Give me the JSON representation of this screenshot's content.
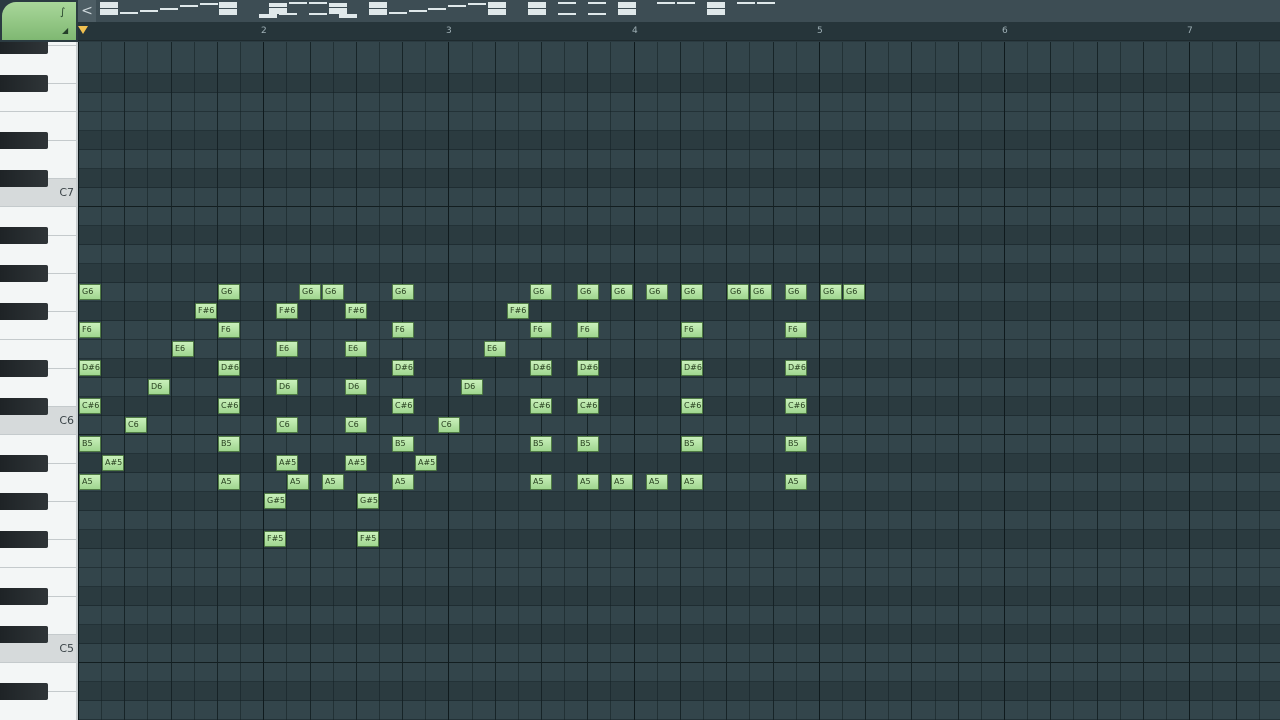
{
  "overview": {
    "scroll_left_label": "<"
  },
  "ruler": {
    "bars": [
      "2",
      "3",
      "4",
      "5",
      "6",
      "7"
    ]
  },
  "keyboard": {
    "octave_labels": [
      "C7",
      "C6",
      "C5"
    ]
  },
  "note_color": "#a9dc98",
  "notes": [
    {
      "name": "G6",
      "pitch": "G6",
      "step": 0
    },
    {
      "name": "F6",
      "pitch": "F6",
      "step": 0
    },
    {
      "name": "D#6",
      "pitch": "D#6",
      "step": 0
    },
    {
      "name": "C#6",
      "pitch": "C#6",
      "step": 0
    },
    {
      "name": "B5",
      "pitch": "B5",
      "step": 0
    },
    {
      "name": "A5",
      "pitch": "A5",
      "step": 0
    },
    {
      "name": "A#5",
      "pitch": "A#5",
      "step": 1
    },
    {
      "name": "C6",
      "pitch": "C6",
      "step": 2
    },
    {
      "name": "D6",
      "pitch": "D6",
      "step": 3
    },
    {
      "name": "E6",
      "pitch": "E6",
      "step": 4
    },
    {
      "name": "F#6",
      "pitch": "F#6",
      "step": 5
    },
    {
      "name": "G6",
      "pitch": "G6",
      "step": 6
    },
    {
      "name": "F6",
      "pitch": "F6",
      "step": 6
    },
    {
      "name": "D#6",
      "pitch": "D#6",
      "step": 6
    },
    {
      "name": "C#6",
      "pitch": "C#6",
      "step": 6
    },
    {
      "name": "B5",
      "pitch": "B5",
      "step": 6
    },
    {
      "name": "A5",
      "pitch": "A5",
      "step": 6
    },
    {
      "name": "G#5",
      "pitch": "G#5",
      "step": 8
    },
    {
      "name": "F#5",
      "pitch": "F#5",
      "step": 8
    },
    {
      "name": "F#6",
      "pitch": "F#6",
      "step": 8.5
    },
    {
      "name": "E6",
      "pitch": "E6",
      "step": 8.5
    },
    {
      "name": "D6",
      "pitch": "D6",
      "step": 8.5
    },
    {
      "name": "C6",
      "pitch": "C6",
      "step": 8.5
    },
    {
      "name": "A#5",
      "pitch": "A#5",
      "step": 8.5
    },
    {
      "name": "A5",
      "pitch": "A5",
      "step": 9
    },
    {
      "name": "G6",
      "pitch": "G6",
      "step": 9.5
    },
    {
      "name": "G6",
      "pitch": "G6",
      "step": 10.5
    },
    {
      "name": "A5",
      "pitch": "A5",
      "step": 10.5
    },
    {
      "name": "F#6",
      "pitch": "F#6",
      "step": 11.5
    },
    {
      "name": "E6",
      "pitch": "E6",
      "step": 11.5
    },
    {
      "name": "D6",
      "pitch": "D6",
      "step": 11.5
    },
    {
      "name": "C6",
      "pitch": "C6",
      "step": 11.5
    },
    {
      "name": "A#5",
      "pitch": "A#5",
      "step": 11.5
    },
    {
      "name": "G#5",
      "pitch": "G#5",
      "step": 12
    },
    {
      "name": "F#5",
      "pitch": "F#5",
      "step": 12
    },
    {
      "name": "G6",
      "pitch": "G6",
      "step": 13.5
    },
    {
      "name": "F6",
      "pitch": "F6",
      "step": 13.5
    },
    {
      "name": "D#6",
      "pitch": "D#6",
      "step": 13.5
    },
    {
      "name": "C#6",
      "pitch": "C#6",
      "step": 13.5
    },
    {
      "name": "B5",
      "pitch": "B5",
      "step": 13.5
    },
    {
      "name": "A5",
      "pitch": "A5",
      "step": 13.5
    },
    {
      "name": "A#5",
      "pitch": "A#5",
      "step": 14.5
    },
    {
      "name": "C6",
      "pitch": "C6",
      "step": 15.5
    },
    {
      "name": "D6",
      "pitch": "D6",
      "step": 16.5
    },
    {
      "name": "E6",
      "pitch": "E6",
      "step": 17.5
    },
    {
      "name": "F#6",
      "pitch": "F#6",
      "step": 18.5
    },
    {
      "name": "G6",
      "pitch": "G6",
      "step": 19.5
    },
    {
      "name": "F6",
      "pitch": "F6",
      "step": 19.5
    },
    {
      "name": "D#6",
      "pitch": "D#6",
      "step": 19.5
    },
    {
      "name": "C#6",
      "pitch": "C#6",
      "step": 19.5
    },
    {
      "name": "B5",
      "pitch": "B5",
      "step": 19.5
    },
    {
      "name": "A5",
      "pitch": "A5",
      "step": 19.5
    },
    {
      "name": "G6",
      "pitch": "G6",
      "step": 21.5
    },
    {
      "name": "F6",
      "pitch": "F6",
      "step": 21.5
    },
    {
      "name": "D#6",
      "pitch": "D#6",
      "step": 21.5
    },
    {
      "name": "C#6",
      "pitch": "C#6",
      "step": 21.5
    },
    {
      "name": "B5",
      "pitch": "B5",
      "step": 21.5
    },
    {
      "name": "A5",
      "pitch": "A5",
      "step": 21.5
    },
    {
      "name": "G6",
      "pitch": "G6",
      "step": 23
    },
    {
      "name": "A5",
      "pitch": "A5",
      "step": 23
    },
    {
      "name": "G6",
      "pitch": "G6",
      "step": 24.5
    },
    {
      "name": "A5",
      "pitch": "A5",
      "step": 24.5
    },
    {
      "name": "G6",
      "pitch": "G6",
      "step": 26
    },
    {
      "name": "F6",
      "pitch": "F6",
      "step": 26
    },
    {
      "name": "D#6",
      "pitch": "D#6",
      "step": 26
    },
    {
      "name": "C#6",
      "pitch": "C#6",
      "step": 26
    },
    {
      "name": "B5",
      "pitch": "B5",
      "step": 26
    },
    {
      "name": "A5",
      "pitch": "A5",
      "step": 26
    },
    {
      "name": "G6",
      "pitch": "G6",
      "step": 28
    },
    {
      "name": "G6",
      "pitch": "G6",
      "step": 29
    },
    {
      "name": "G6",
      "pitch": "G6",
      "step": 30.5
    },
    {
      "name": "F6",
      "pitch": "F6",
      "step": 30.5
    },
    {
      "name": "D#6",
      "pitch": "D#6",
      "step": 30.5
    },
    {
      "name": "C#6",
      "pitch": "C#6",
      "step": 30.5
    },
    {
      "name": "B5",
      "pitch": "B5",
      "step": 30.5
    },
    {
      "name": "A5",
      "pitch": "A5",
      "step": 30.5
    },
    {
      "name": "G6",
      "pitch": "G6",
      "step": 32
    },
    {
      "name": "G6",
      "pitch": "G6",
      "step": 33
    }
  ]
}
